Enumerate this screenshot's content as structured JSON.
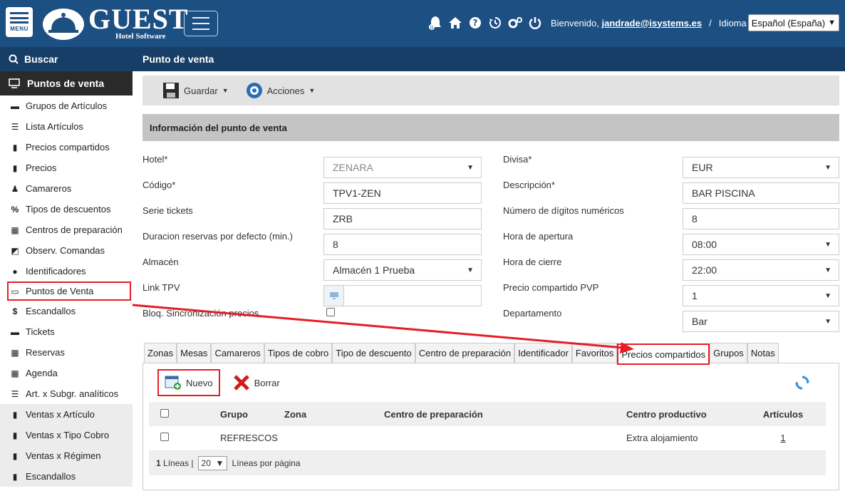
{
  "header": {
    "menu_label": "MENU",
    "logo_title": "GUEST",
    "logo_subtitle": "Hotel Software",
    "notification_count": "0",
    "welcome_prefix": "Bienvenido,",
    "user": "jandrade@isystems.es",
    "separator": "/",
    "language_label": "Idioma",
    "language_value": "Español (España)"
  },
  "sidebar": {
    "search_label": "Buscar",
    "section_title": "Puntos de venta",
    "items": [
      {
        "label": "Grupos de Artículos",
        "icon": "folder-icon"
      },
      {
        "label": "Lista Artículos",
        "icon": "list-icon"
      },
      {
        "label": "Precios compartidos",
        "icon": "file-icon"
      },
      {
        "label": "Precios",
        "icon": "file-excel-icon"
      },
      {
        "label": "Camareros",
        "icon": "person-icon"
      },
      {
        "label": "Tipos de descuentos",
        "icon": "percent-icon"
      },
      {
        "label": "Centros de preparación",
        "icon": "building-icon"
      },
      {
        "label": "Observ. Comandas",
        "icon": "edit-icon"
      },
      {
        "label": "Identificadores",
        "icon": "user-circle-icon"
      },
      {
        "label": "Puntos de Venta",
        "icon": "monitor-icon"
      },
      {
        "label": "Escandallos",
        "icon": "dollar-icon"
      },
      {
        "label": "Tickets",
        "icon": "ticket-icon"
      },
      {
        "label": "Reservas",
        "icon": "calendar-icon"
      },
      {
        "label": "Agenda",
        "icon": "calendar-grid-icon"
      },
      {
        "label": "Art. x Subgr. analíticos",
        "icon": "list-icon"
      },
      {
        "label": "Ventas x Artículo",
        "icon": "file-icon"
      },
      {
        "label": "Ventas x Tipo Cobro",
        "icon": "file-icon"
      },
      {
        "label": "Ventas x Régimen",
        "icon": "file-icon"
      },
      {
        "label": "Escandallos",
        "icon": "file-icon"
      }
    ]
  },
  "main": {
    "title": "Punto de venta",
    "toolbar": {
      "save_label": "Guardar",
      "actions_label": "Acciones"
    },
    "info_title": "Información del punto de venta",
    "form": {
      "hotel_label": "Hotel*",
      "hotel_value": "ZENARA",
      "divisa_label": "Divisa*",
      "divisa_value": "EUR",
      "codigo_label": "Código*",
      "codigo_value": "TPV1-ZEN",
      "descripcion_label": "Descripción*",
      "descripcion_value": "BAR PISCINA",
      "serie_label": "Serie tickets",
      "serie_value": "ZRB",
      "digitos_label": "Número de dígitos numéricos",
      "digitos_value": "8",
      "duracion_label": "Duracion reservas por defecto (min.)",
      "duracion_value": "8",
      "apertura_label": "Hora de apertura",
      "apertura_value": "08:00",
      "almacen_label": "Almacén",
      "almacen_value": "Almacén 1 Prueba",
      "cierre_label": "Hora de cierre",
      "cierre_value": "22:00",
      "link_label": "Link TPV",
      "link_value": "",
      "precio_label": "Precio compartido PVP",
      "precio_value": "1",
      "bloq_label": "Bloq. Sincronización precios",
      "depto_label": "Departamento",
      "depto_value": "Bar"
    },
    "tabs": [
      "Zonas",
      "Mesas",
      "Camareros",
      "Tipos de cobro",
      "Tipo de descuento",
      "Centro de preparación",
      "Identificador",
      "Favoritos",
      "Precios compartidos",
      "Grupos",
      "Notas"
    ],
    "active_tab": "Precios compartidos",
    "grid": {
      "new_label": "Nuevo",
      "delete_label": "Borrar",
      "columns": [
        "Grupo",
        "Zona",
        "Centro de preparación",
        "Centro productivo",
        "Artículos"
      ],
      "rows": [
        {
          "grupo": "REFRESCOS",
          "zona": "",
          "centro_prep": "",
          "centro_prod": "Extra alojamiento",
          "articulos": "1"
        }
      ],
      "pager_count": "1",
      "pager_lines": "Líneas |",
      "pager_size": "20",
      "pager_suffix": "Líneas por página"
    }
  },
  "colors": {
    "header": "#1c4f82",
    "dark_bar": "#173e66",
    "highlight": "#e41e26"
  }
}
